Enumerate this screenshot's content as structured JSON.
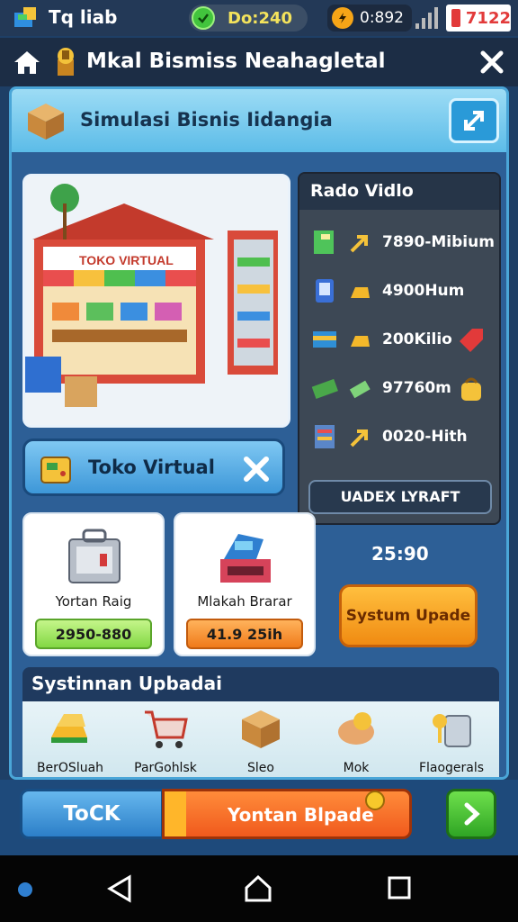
{
  "status_bar": {
    "app_name": "Tq liab",
    "pill_text": "Do:240",
    "clock_text": "0:892",
    "battery_text": "7122"
  },
  "title_bar": {
    "title": "Mkal Bismiss Neahagletal"
  },
  "panel": {
    "header_title": "Simulasi Bisnis Iidangia",
    "store_button_label": "Toko Virtual",
    "right_list": {
      "title": "Rado Vidlo",
      "items": [
        {
          "value": "7890-Mibium"
        },
        {
          "value": "4900Hum"
        },
        {
          "value": "200Kilio"
        },
        {
          "value": "97760m"
        },
        {
          "value": "0020-Hith"
        }
      ],
      "button_label": "UADEX LYRAFT"
    },
    "cards": [
      {
        "name": "Yortan Raig",
        "value": "2950-880"
      },
      {
        "name": "Mlakah Brarar",
        "value": "41.9 25ih"
      }
    ],
    "timer": "25:90",
    "upgrade_button_label": "Systum Upade",
    "system_section": {
      "title": "Systinnan Upbadai",
      "items": [
        {
          "label": "BerOSluah"
        },
        {
          "label": "ParGohlsk"
        },
        {
          "label": "Sleo"
        },
        {
          "label": "Mok"
        },
        {
          "label": "Flaogerals"
        }
      ]
    }
  },
  "bottom_bar": {
    "tock_label": "ToCK",
    "upgrade_label": "Yontan Blpade"
  },
  "colors": {
    "background": "#1e3f66",
    "accent_blue": "#4aa6d8",
    "orange": "#f08b12",
    "green": "#2fa524"
  }
}
